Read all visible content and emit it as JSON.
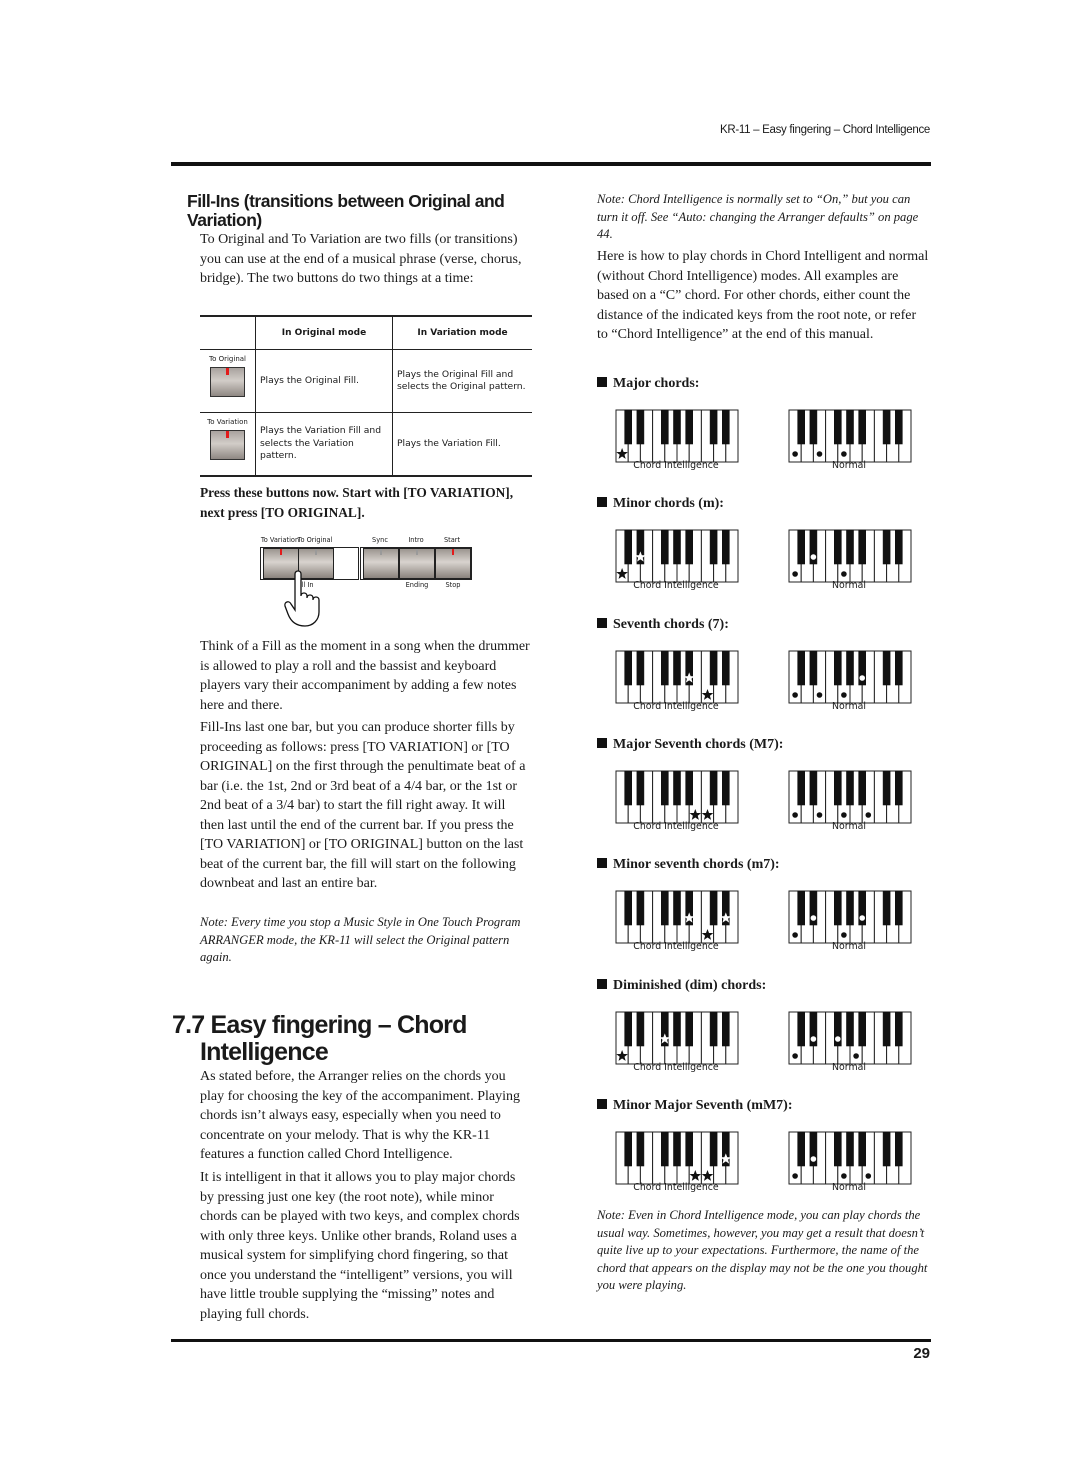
{
  "header": {
    "running_head": "KR-11 – Easy fingering – Chord Intelligence",
    "page_number": "29"
  },
  "left": {
    "fillins_heading_line1": "Fill-Ins (transitions between Original and",
    "fillins_heading_line2": "Variation)",
    "intro": "To Original and To Variation are two fills (or transitions) you can use at the end of a musical phrase (verse, chorus, bridge). The two buttons do two things at a time:",
    "table": {
      "headers": [
        "",
        "In Original mode",
        "In Variation mode"
      ],
      "rows": [
        {
          "button_label": "To Original",
          "original_mode": "Plays the Original Fill.",
          "variation_mode": "Plays the Original Fill and selects the Original pattern."
        },
        {
          "button_label": "To Variation",
          "original_mode": "Plays the Variation Fill and selects the Variation pattern.",
          "variation_mode": "Plays the Variation Fill."
        }
      ]
    },
    "instruction": "Press these buttons now. Start with [TO VARIATION], next press [TO ORIGINAL].",
    "panel": {
      "buttons": [
        {
          "label": "To Variation",
          "led": "on"
        },
        {
          "label": "To Original",
          "led": "off"
        },
        {
          "label": "Sync",
          "led": "off"
        },
        {
          "label": "Intro",
          "led": "off"
        },
        {
          "label": "Start",
          "led": "on"
        }
      ],
      "sub_labels": {
        "fill_in": "Fill In",
        "ending": "Ending",
        "stop": "Stop"
      },
      "led_on_color": "#e31b1b",
      "led_off_color": "#9a9a9a"
    },
    "para_fill": "Think of a Fill as the moment in a song when the drummer is allowed to play a roll and the bassist and keyboard players vary their accompaniment by adding a few notes here and there.",
    "para_fillins": "Fill-Ins last one bar, but you can produce shorter fills by proceeding as follows: press [TO VARIATION] or [TO ORIGINAL] on the first through the penultimate beat of a bar (i.e. the 1st, 2nd or 3rd beat of a 4/4 bar, or the 1st or 2nd beat of a 3/4 bar) to start the fill right away. It will then last until the end of the current bar. If you press the [TO VARIATION] or [TO ORIGINAL] button on the last beat of the current bar, the fill will start on the following downbeat and last an entire bar.",
    "note_stop": "Note: Every time you stop a Music Style in One Touch Program ARRANGER mode, the KR-11 will select the Original pattern again.",
    "section_number": "7.7",
    "section_title_line1": "Easy fingering – Chord",
    "section_title_line2": "Intelligence",
    "para_arranger": "As stated before, the Arranger relies on the chords you play for choosing the key of the accompaniment. Playing chords isn’t always easy, especially when you need to concentrate on your melody. That is why the KR-11 features a function called Chord Intelligence.",
    "para_intelligent": "It is intelligent in that it allows you to play major chords by pressing just one key (the root note), while minor chords can be played with two keys, and complex chords with only three keys. Unlike other brands, Roland uses a musical system for simplifying chord fingering, so that once you understand the “intelligent” versions, you will have little trouble supplying the “missing” notes and playing full chords."
  },
  "right": {
    "note_default": "Note: Chord Intelligence is normally set to “On,” but you can turn it off. See “Auto: changing the Arranger defaults” on page 44.",
    "para_howto": "Here is how to play chords in Chord Intelligent and normal (without Chord Intelligence) modes. All examples are based on a “C” chord. For other chords, either count the distance of the indicated keys from the root note, or refer to “Chord Intelligence” at the end of this manual.",
    "caption_ci": "Chord Intelligence",
    "caption_normal": "Normal",
    "keyboard_keys": {
      "white": [
        "C",
        "D",
        "E",
        "F",
        "G",
        "A",
        "B",
        "C2",
        "D2",
        "E2"
      ],
      "black": [
        "C#",
        "D#",
        "F#",
        "G#",
        "A#",
        "C#2",
        "D#2"
      ]
    },
    "chords": [
      {
        "title": "Major chords:",
        "ci_keys": [
          "C"
        ],
        "normal_keys": [
          "C",
          "E",
          "G"
        ]
      },
      {
        "title": "Minor chords (m):",
        "ci_keys": [
          "C",
          "D#"
        ],
        "normal_keys": [
          "C",
          "D#",
          "G"
        ]
      },
      {
        "title": "Seventh chords (7):",
        "ci_keys": [
          "A#",
          "C2"
        ],
        "normal_keys": [
          "C",
          "E",
          "G",
          "A#"
        ]
      },
      {
        "title": "Major Seventh chords (M7):",
        "ci_keys": [
          "B",
          "C2"
        ],
        "normal_keys": [
          "C",
          "E",
          "G",
          "B"
        ]
      },
      {
        "title": "Minor seventh chords (m7):",
        "ci_keys": [
          "A#",
          "C2",
          "D#2"
        ],
        "normal_keys": [
          "C",
          "D#",
          "G",
          "A#"
        ]
      },
      {
        "title": "Diminished (dim) chords:",
        "ci_keys": [
          "C",
          "F#"
        ],
        "normal_keys": [
          "C",
          "D#",
          "F#",
          "A"
        ]
      },
      {
        "title": "Minor Major Seventh (mM7):",
        "ci_keys": [
          "B",
          "C2",
          "D#2"
        ],
        "normal_keys": [
          "C",
          "D#",
          "G",
          "B"
        ]
      }
    ],
    "note_even": "Note: Even in Chord Intelligence mode, you can play chords the usual way. Sometimes, however, you may get a result that doesn’t quite live up to your expectations. Furthermore, the name of the chord that appears on the display may not be the one you thought you were playing."
  }
}
